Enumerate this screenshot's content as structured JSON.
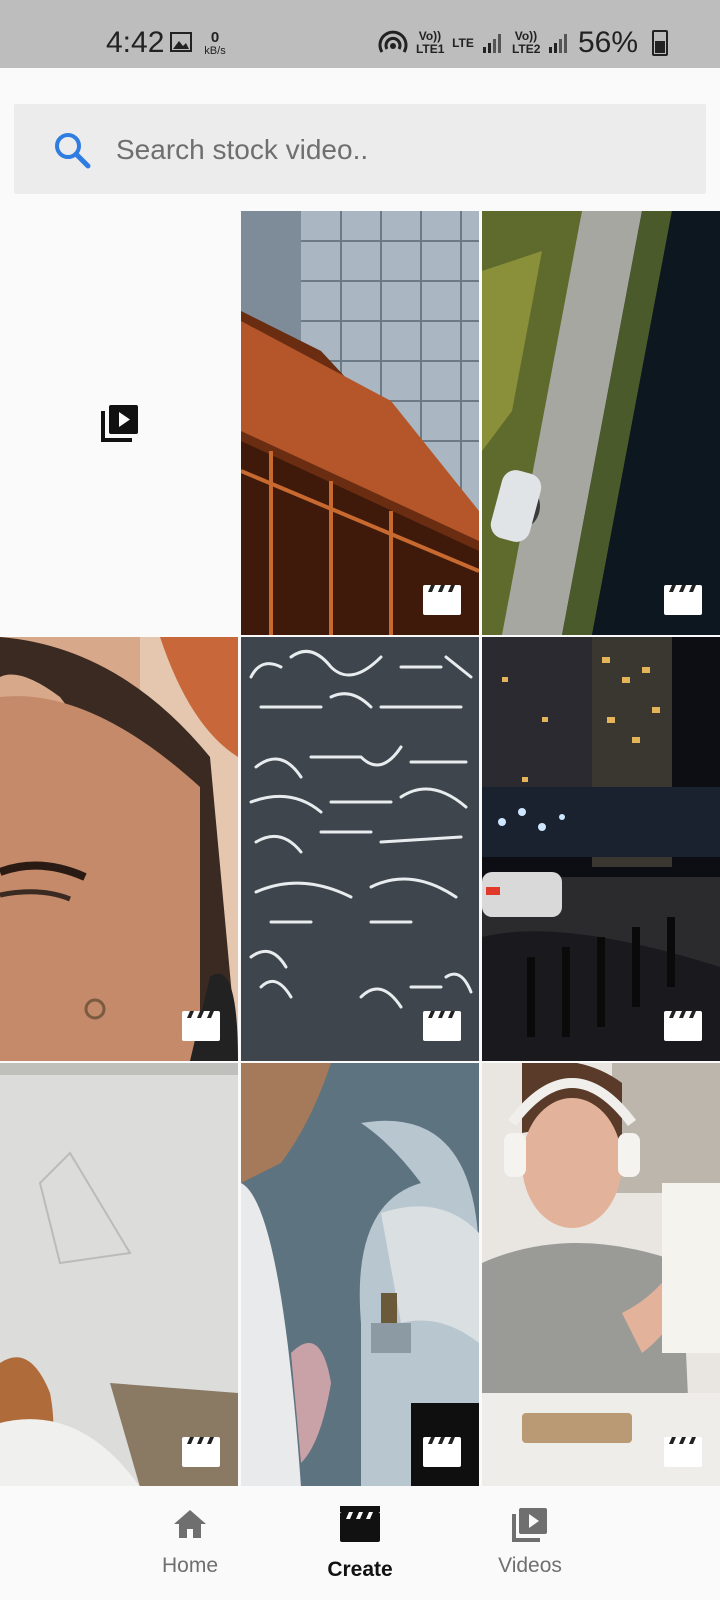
{
  "status_bar": {
    "time": "4:42",
    "net_speed_value": "0",
    "net_speed_unit": "kB/s",
    "sim1_label": "Vo)) LTE1",
    "sim1_net": "LTE",
    "sim2_label": "Vo)) LTE2",
    "battery": "56%"
  },
  "search": {
    "placeholder": "Search stock video.."
  },
  "grid": {
    "tiles": [
      {
        "kind": "library",
        "icon": "video-library-icon"
      },
      {
        "kind": "video",
        "subject": "city-train"
      },
      {
        "kind": "video",
        "subject": "road-aerial"
      },
      {
        "kind": "video",
        "subject": "woman-face"
      },
      {
        "kind": "video",
        "subject": "chalkboard-math"
      },
      {
        "kind": "video",
        "subject": "night-city-street"
      },
      {
        "kind": "video",
        "subject": "girl-at-whiteboard"
      },
      {
        "kind": "video",
        "subject": "microscope"
      },
      {
        "kind": "video",
        "subject": "boy-headphones"
      }
    ]
  },
  "bottom_nav": {
    "items": [
      {
        "label": "Home",
        "icon": "home-icon",
        "active": false
      },
      {
        "label": "Create",
        "icon": "movie-clapper-icon",
        "active": true
      },
      {
        "label": "Videos",
        "icon": "video-library-icon",
        "active": false
      }
    ]
  },
  "colors": {
    "status_bar_bg": "#bdbdbd",
    "search_bg": "#ececec",
    "search_icon": "#2f7de1",
    "nav_inactive": "#6f6f6f",
    "nav_active": "#111111"
  }
}
